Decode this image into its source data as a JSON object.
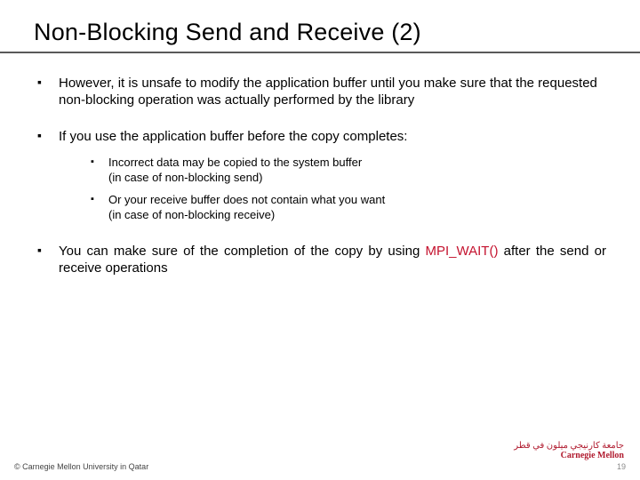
{
  "title": "Non-Blocking Send and Receive (2)",
  "bullets": {
    "b1": "However, it is unsafe to modify the application buffer until you make sure that the requested non-blocking operation was actually performed by the library",
    "b2": "If you use the application buffer before the copy completes:",
    "b2_1_a": "Incorrect data may be copied to the system buffer ",
    "b2_1_b": "(in case of non-blocking send)",
    "b2_2_a": "Or your receive buffer does not contain what you want ",
    "b2_2_b": "(in case of non-blocking receive)",
    "b3_a": "You can make sure of the completion of the copy by using ",
    "b3_hl": "MPI_WAIT()",
    "b3_b": " after the send or receive operations"
  },
  "footer": {
    "copyright": "© Carnegie Mellon University in Qatar",
    "page": "19"
  },
  "logo": {
    "arabic": "جامعة كارنيجي ميلون في قطر",
    "english": "Carnegie Mellon"
  }
}
